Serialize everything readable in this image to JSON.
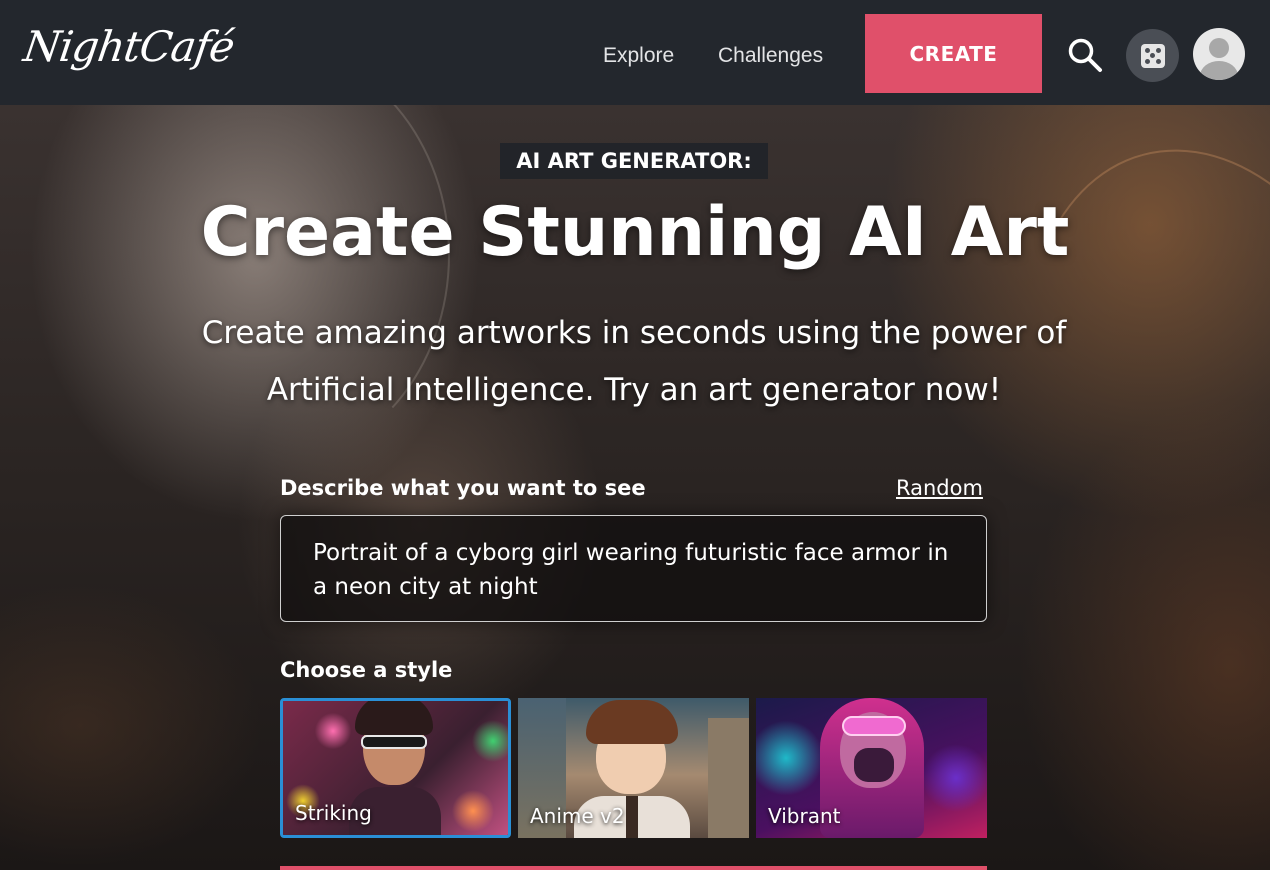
{
  "nav": {
    "logo": "NightCafé",
    "links": [
      "Explore",
      "Challenges"
    ],
    "create_label": "CREATE",
    "colors": {
      "bar": "#23272d",
      "accent": "#e0506a"
    }
  },
  "hero": {
    "badge": "AI ART GENERATOR:",
    "title": "Create Stunning AI Art",
    "subtitle": "Create amazing artworks in seconds using the power of Artificial Intelligence. Try an art generator now!"
  },
  "prompt": {
    "label": "Describe what you want to see",
    "random_label": "Random",
    "value": "Portrait of a cyborg girl wearing futuristic face armor in a neon city at night"
  },
  "styles": {
    "label": "Choose a style",
    "options": [
      {
        "name": "Striking",
        "selected": true
      },
      {
        "name": "Anime v2",
        "selected": false
      },
      {
        "name": "Vibrant",
        "selected": false
      }
    ],
    "selected_border_color": "#2a8fd6"
  }
}
